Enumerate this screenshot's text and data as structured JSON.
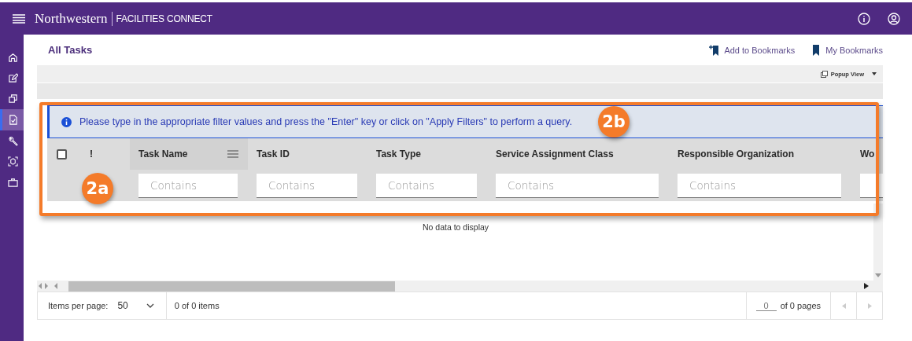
{
  "topbar": {
    "brand": "Northwestern",
    "product": "FACILITIES CONNECT"
  },
  "sidebar": {
    "items": [
      {
        "selected": false
      },
      {
        "selected": false
      },
      {
        "selected": false
      },
      {
        "selected": true
      },
      {
        "selected": false
      },
      {
        "selected": false
      },
      {
        "selected": false
      }
    ]
  },
  "page": {
    "title": "All Tasks",
    "actions": [
      "Add to Bookmarks",
      "My Bookmarks"
    ],
    "toolbar": {
      "view": "Popup View"
    }
  },
  "grid": {
    "banner": "Please type in the appropriate filter values and press the \"Enter\" key or click on \"Apply Filters\" to perform a query.",
    "select_all": {
      "checked": false
    },
    "priority_column": "!",
    "columns": [
      {
        "label": "Task Name",
        "placeholder": "Contains",
        "menu": true
      },
      {
        "label": "Task ID",
        "placeholder": "Contains",
        "menu": false
      },
      {
        "label": "Task Type",
        "placeholder": "Contains",
        "menu": false
      },
      {
        "label": "Service Assignment Class",
        "placeholder": "Contains",
        "menu": false
      },
      {
        "label": "Responsible Organization",
        "placeholder": "Contains",
        "menu": false
      },
      {
        "label": "Wo"
      }
    ],
    "empty_message": "No data to display"
  },
  "footer": {
    "items_per_page_label": "Items per page:",
    "items_per_page": "50",
    "count": "0 of 0 items",
    "page": "0",
    "pages": "of 0 pages"
  },
  "callouts": [
    {
      "label": "2b"
    },
    {
      "label": "2a"
    }
  ]
}
